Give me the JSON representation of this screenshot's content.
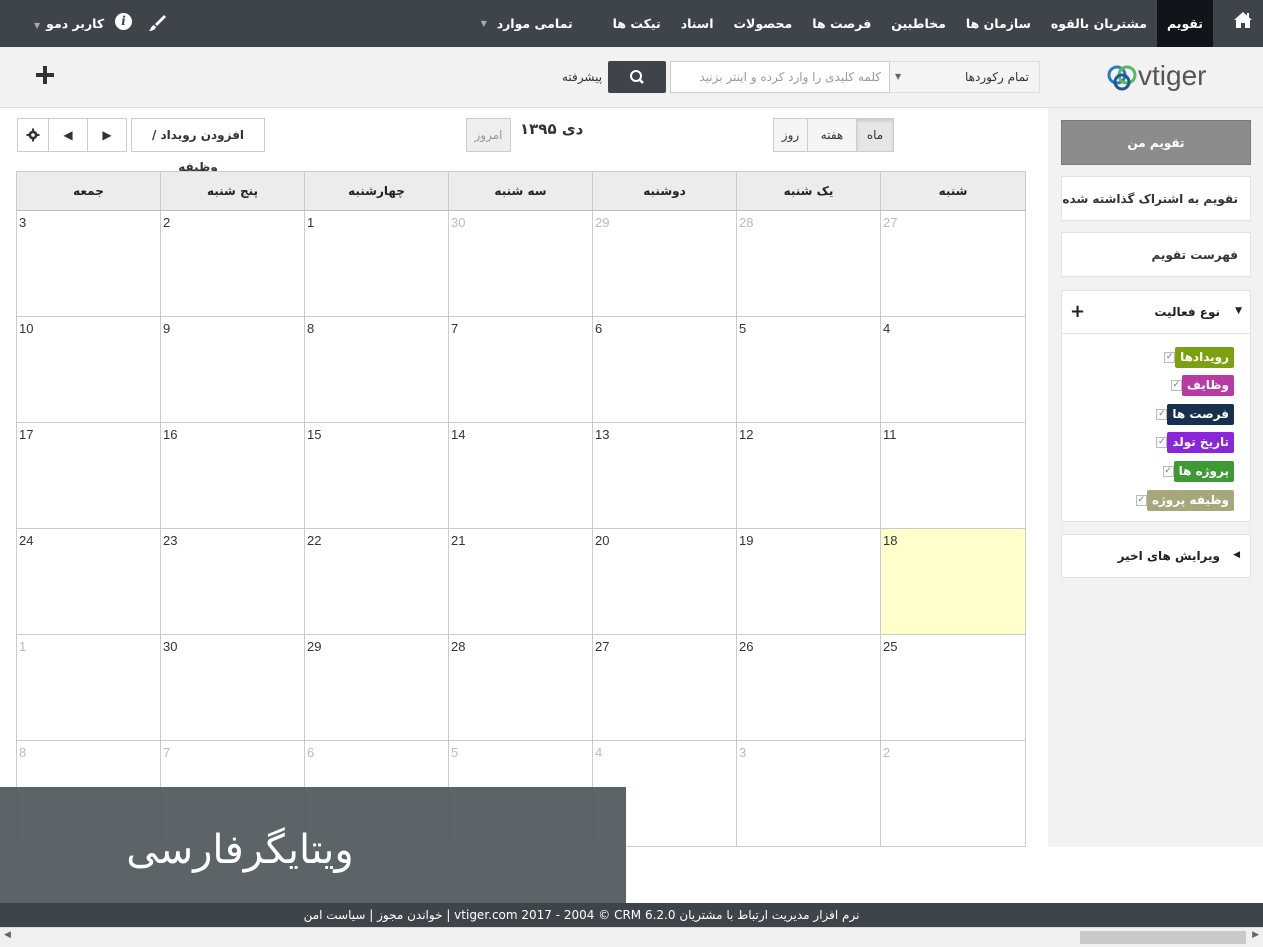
{
  "nav": {
    "items": [
      {
        "label": "تقویم",
        "active": true
      },
      {
        "label": "مشتریان بالقوه"
      },
      {
        "label": "سازمان ها"
      },
      {
        "label": "مخاطبین"
      },
      {
        "label": "فرصت ها"
      },
      {
        "label": "محصولات"
      },
      {
        "label": "اسناد"
      },
      {
        "label": "تیکت ها"
      },
      {
        "label": "تمامی موارد"
      }
    ],
    "user": "کاربر دمو"
  },
  "search": {
    "record_scope": "تمام رکوردها",
    "placeholder": "کلمه کلیدی را وارد کرده و اینتر بزنید",
    "advanced": "پیشرفته"
  },
  "logo": "vtiger",
  "toolbar": {
    "add_event": "افزودن رویداد / وظیفه",
    "today": "امروز",
    "title": "دی ۱۳۹۵",
    "views": [
      "ماه",
      "هفته",
      "روز"
    ],
    "active_view": "ماه"
  },
  "calendar": {
    "weekdays": [
      "شنبه",
      "یک شنبه",
      "دوشنبه",
      "سه شنبه",
      "چهارشنبه",
      "پنج شنبه",
      "جمعه"
    ],
    "weeks": [
      [
        {
          "d": "27",
          "o": true
        },
        {
          "d": "28",
          "o": true
        },
        {
          "d": "29",
          "o": true
        },
        {
          "d": "30",
          "o": true
        },
        {
          "d": "1"
        },
        {
          "d": "2"
        },
        {
          "d": "3"
        }
      ],
      [
        {
          "d": "4"
        },
        {
          "d": "5"
        },
        {
          "d": "6"
        },
        {
          "d": "7"
        },
        {
          "d": "8"
        },
        {
          "d": "9"
        },
        {
          "d": "10"
        }
      ],
      [
        {
          "d": "11"
        },
        {
          "d": "12"
        },
        {
          "d": "13"
        },
        {
          "d": "14"
        },
        {
          "d": "15"
        },
        {
          "d": "16"
        },
        {
          "d": "17"
        }
      ],
      [
        {
          "d": "18",
          "today": true
        },
        {
          "d": "19"
        },
        {
          "d": "20"
        },
        {
          "d": "21"
        },
        {
          "d": "22"
        },
        {
          "d": "23"
        },
        {
          "d": "24"
        }
      ],
      [
        {
          "d": "25"
        },
        {
          "d": "26"
        },
        {
          "d": "27"
        },
        {
          "d": "28"
        },
        {
          "d": "29"
        },
        {
          "d": "30"
        },
        {
          "d": "1",
          "o": true
        }
      ],
      [
        {
          "d": "2",
          "o": true
        },
        {
          "d": "3",
          "o": true
        },
        {
          "d": "4",
          "o": true
        },
        {
          "d": "5",
          "o": true
        },
        {
          "d": "6",
          "o": true
        },
        {
          "d": "7",
          "o": true
        },
        {
          "d": "8",
          "o": true
        }
      ]
    ]
  },
  "sidebar": {
    "my_calendar": "تقویم من",
    "shared_calendar": "تقویم به اشتراک گذاشته شده",
    "calendar_list": "فهرست تقویم",
    "activity_type": {
      "title": "نوع فعالیت",
      "items": [
        {
          "label": "رویدادها",
          "color": "#7ba20e"
        },
        {
          "label": "وظایف",
          "color": "#b83aa2"
        },
        {
          "label": "فرصت ها",
          "color": "#16314f"
        },
        {
          "label": "تاریخ تولد",
          "color": "#8b26d8"
        },
        {
          "label": "پروژه ها",
          "color": "#3f9a34"
        },
        {
          "label": "وظیفه پروژه",
          "color": "#a6a77a"
        }
      ]
    },
    "recent_edits": "ویرایش های اخیر"
  },
  "footer": "نرم افزار مدیریت ارتباط با مشتریان vtiger.com 2017 - 2004 © CRM 6.2.0 | خواندن مجوز | سیاست امن",
  "watermark": "ویتایگرفارسی"
}
